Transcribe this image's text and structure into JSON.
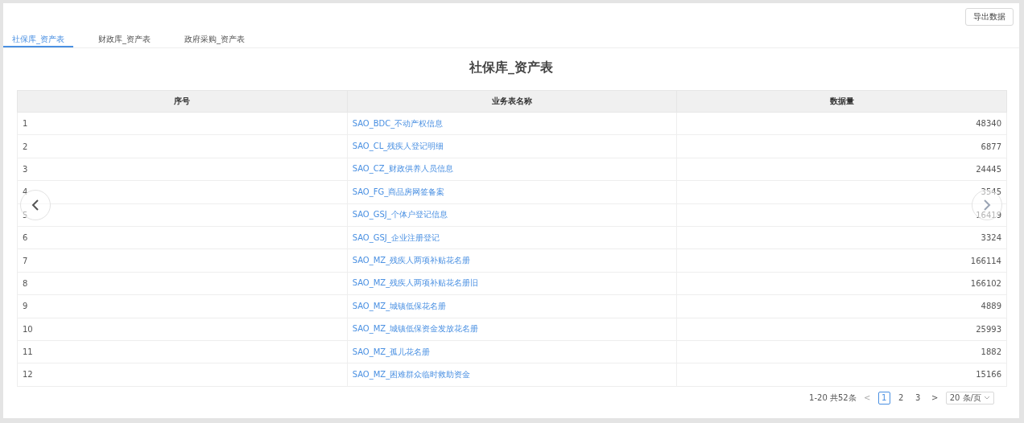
{
  "toolbar": {
    "export_button": "导出数据"
  },
  "tabs": [
    {
      "label": "社保库_资产表",
      "selected": true
    },
    {
      "label": "财政库_资产表",
      "selected": false
    },
    {
      "label": "政府采购_资产表",
      "selected": false
    }
  ],
  "title": "社保库_资产表",
  "table": {
    "columns": [
      "序号",
      "业务表名称",
      "数据量"
    ],
    "rows": [
      [
        "1",
        "SAO_BDC_不动产权信息",
        "48340"
      ],
      [
        "2",
        "SAO_CL_残疾人登记明细",
        "6877"
      ],
      [
        "3",
        "SAO_CZ_财政供养人员信息",
        "24445"
      ],
      [
        "4",
        "SAO_FG_商品房网签备案",
        "3545"
      ],
      [
        "5",
        "SAO_GSJ_个体户登记信息",
        "16419"
      ],
      [
        "6",
        "SAO_GSJ_企业注册登记",
        "3324"
      ],
      [
        "7",
        "SAO_MZ_残疾人两项补贴花名册",
        "166114"
      ],
      [
        "8",
        "SAO_MZ_残疾人两项补贴花名册旧",
        "166102"
      ],
      [
        "9",
        "SAO_MZ_城镇低保花名册",
        "4889"
      ],
      [
        "10",
        "SAO_MZ_城镇低保资金发放花名册",
        "25993"
      ],
      [
        "11",
        "SAO_MZ_孤儿花名册",
        "1882"
      ],
      [
        "12",
        "SAO_MZ_困难群众临时救助资金",
        "15166"
      ]
    ]
  },
  "pagination": {
    "total": "1-20 共52条",
    "prev": "<",
    "pages": [
      {
        "label": "1",
        "selected": true
      },
      {
        "label": "2",
        "selected": false
      },
      {
        "label": "3",
        "selected": false
      }
    ],
    "next": ">",
    "page_size": "20 条/页"
  }
}
